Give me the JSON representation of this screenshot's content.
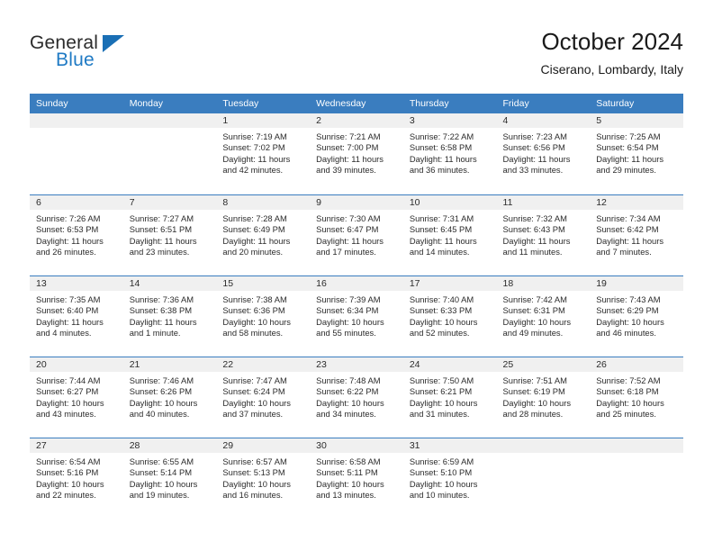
{
  "brand": {
    "name_part1": "General",
    "name_part2": "Blue",
    "triangle_icon": "logo-triangle",
    "accent_color": "#1a6fb5"
  },
  "header": {
    "title": "October 2024",
    "subtitle": "Ciserano, Lombardy, Italy"
  },
  "theme": {
    "header_band": "#3a7dbf",
    "daynum_band": "#f0f0f0",
    "text": "#2b2b2b"
  },
  "weekday_headers": [
    "Sunday",
    "Monday",
    "Tuesday",
    "Wednesday",
    "Thursday",
    "Friday",
    "Saturday"
  ],
  "labels": {
    "sunrise_prefix": "Sunrise:",
    "sunset_prefix": "Sunset:",
    "daylight_prefix": "Daylight:"
  },
  "weeks": [
    [
      {
        "day": "",
        "sunrise": "",
        "sunset": "",
        "daylight_line1": "",
        "daylight_line2": ""
      },
      {
        "day": "",
        "sunrise": "",
        "sunset": "",
        "daylight_line1": "",
        "daylight_line2": ""
      },
      {
        "day": "1",
        "sunrise": "Sunrise: 7:19 AM",
        "sunset": "Sunset: 7:02 PM",
        "daylight_line1": "Daylight: 11 hours",
        "daylight_line2": "and 42 minutes."
      },
      {
        "day": "2",
        "sunrise": "Sunrise: 7:21 AM",
        "sunset": "Sunset: 7:00 PM",
        "daylight_line1": "Daylight: 11 hours",
        "daylight_line2": "and 39 minutes."
      },
      {
        "day": "3",
        "sunrise": "Sunrise: 7:22 AM",
        "sunset": "Sunset: 6:58 PM",
        "daylight_line1": "Daylight: 11 hours",
        "daylight_line2": "and 36 minutes."
      },
      {
        "day": "4",
        "sunrise": "Sunrise: 7:23 AM",
        "sunset": "Sunset: 6:56 PM",
        "daylight_line1": "Daylight: 11 hours",
        "daylight_line2": "and 33 minutes."
      },
      {
        "day": "5",
        "sunrise": "Sunrise: 7:25 AM",
        "sunset": "Sunset: 6:54 PM",
        "daylight_line1": "Daylight: 11 hours",
        "daylight_line2": "and 29 minutes."
      }
    ],
    [
      {
        "day": "6",
        "sunrise": "Sunrise: 7:26 AM",
        "sunset": "Sunset: 6:53 PM",
        "daylight_line1": "Daylight: 11 hours",
        "daylight_line2": "and 26 minutes."
      },
      {
        "day": "7",
        "sunrise": "Sunrise: 7:27 AM",
        "sunset": "Sunset: 6:51 PM",
        "daylight_line1": "Daylight: 11 hours",
        "daylight_line2": "and 23 minutes."
      },
      {
        "day": "8",
        "sunrise": "Sunrise: 7:28 AM",
        "sunset": "Sunset: 6:49 PM",
        "daylight_line1": "Daylight: 11 hours",
        "daylight_line2": "and 20 minutes."
      },
      {
        "day": "9",
        "sunrise": "Sunrise: 7:30 AM",
        "sunset": "Sunset: 6:47 PM",
        "daylight_line1": "Daylight: 11 hours",
        "daylight_line2": "and 17 minutes."
      },
      {
        "day": "10",
        "sunrise": "Sunrise: 7:31 AM",
        "sunset": "Sunset: 6:45 PM",
        "daylight_line1": "Daylight: 11 hours",
        "daylight_line2": "and 14 minutes."
      },
      {
        "day": "11",
        "sunrise": "Sunrise: 7:32 AM",
        "sunset": "Sunset: 6:43 PM",
        "daylight_line1": "Daylight: 11 hours",
        "daylight_line2": "and 11 minutes."
      },
      {
        "day": "12",
        "sunrise": "Sunrise: 7:34 AM",
        "sunset": "Sunset: 6:42 PM",
        "daylight_line1": "Daylight: 11 hours",
        "daylight_line2": "and 7 minutes."
      }
    ],
    [
      {
        "day": "13",
        "sunrise": "Sunrise: 7:35 AM",
        "sunset": "Sunset: 6:40 PM",
        "daylight_line1": "Daylight: 11 hours",
        "daylight_line2": "and 4 minutes."
      },
      {
        "day": "14",
        "sunrise": "Sunrise: 7:36 AM",
        "sunset": "Sunset: 6:38 PM",
        "daylight_line1": "Daylight: 11 hours",
        "daylight_line2": "and 1 minute."
      },
      {
        "day": "15",
        "sunrise": "Sunrise: 7:38 AM",
        "sunset": "Sunset: 6:36 PM",
        "daylight_line1": "Daylight: 10 hours",
        "daylight_line2": "and 58 minutes."
      },
      {
        "day": "16",
        "sunrise": "Sunrise: 7:39 AM",
        "sunset": "Sunset: 6:34 PM",
        "daylight_line1": "Daylight: 10 hours",
        "daylight_line2": "and 55 minutes."
      },
      {
        "day": "17",
        "sunrise": "Sunrise: 7:40 AM",
        "sunset": "Sunset: 6:33 PM",
        "daylight_line1": "Daylight: 10 hours",
        "daylight_line2": "and 52 minutes."
      },
      {
        "day": "18",
        "sunrise": "Sunrise: 7:42 AM",
        "sunset": "Sunset: 6:31 PM",
        "daylight_line1": "Daylight: 10 hours",
        "daylight_line2": "and 49 minutes."
      },
      {
        "day": "19",
        "sunrise": "Sunrise: 7:43 AM",
        "sunset": "Sunset: 6:29 PM",
        "daylight_line1": "Daylight: 10 hours",
        "daylight_line2": "and 46 minutes."
      }
    ],
    [
      {
        "day": "20",
        "sunrise": "Sunrise: 7:44 AM",
        "sunset": "Sunset: 6:27 PM",
        "daylight_line1": "Daylight: 10 hours",
        "daylight_line2": "and 43 minutes."
      },
      {
        "day": "21",
        "sunrise": "Sunrise: 7:46 AM",
        "sunset": "Sunset: 6:26 PM",
        "daylight_line1": "Daylight: 10 hours",
        "daylight_line2": "and 40 minutes."
      },
      {
        "day": "22",
        "sunrise": "Sunrise: 7:47 AM",
        "sunset": "Sunset: 6:24 PM",
        "daylight_line1": "Daylight: 10 hours",
        "daylight_line2": "and 37 minutes."
      },
      {
        "day": "23",
        "sunrise": "Sunrise: 7:48 AM",
        "sunset": "Sunset: 6:22 PM",
        "daylight_line1": "Daylight: 10 hours",
        "daylight_line2": "and 34 minutes."
      },
      {
        "day": "24",
        "sunrise": "Sunrise: 7:50 AM",
        "sunset": "Sunset: 6:21 PM",
        "daylight_line1": "Daylight: 10 hours",
        "daylight_line2": "and 31 minutes."
      },
      {
        "day": "25",
        "sunrise": "Sunrise: 7:51 AM",
        "sunset": "Sunset: 6:19 PM",
        "daylight_line1": "Daylight: 10 hours",
        "daylight_line2": "and 28 minutes."
      },
      {
        "day": "26",
        "sunrise": "Sunrise: 7:52 AM",
        "sunset": "Sunset: 6:18 PM",
        "daylight_line1": "Daylight: 10 hours",
        "daylight_line2": "and 25 minutes."
      }
    ],
    [
      {
        "day": "27",
        "sunrise": "Sunrise: 6:54 AM",
        "sunset": "Sunset: 5:16 PM",
        "daylight_line1": "Daylight: 10 hours",
        "daylight_line2": "and 22 minutes."
      },
      {
        "day": "28",
        "sunrise": "Sunrise: 6:55 AM",
        "sunset": "Sunset: 5:14 PM",
        "daylight_line1": "Daylight: 10 hours",
        "daylight_line2": "and 19 minutes."
      },
      {
        "day": "29",
        "sunrise": "Sunrise: 6:57 AM",
        "sunset": "Sunset: 5:13 PM",
        "daylight_line1": "Daylight: 10 hours",
        "daylight_line2": "and 16 minutes."
      },
      {
        "day": "30",
        "sunrise": "Sunrise: 6:58 AM",
        "sunset": "Sunset: 5:11 PM",
        "daylight_line1": "Daylight: 10 hours",
        "daylight_line2": "and 13 minutes."
      },
      {
        "day": "31",
        "sunrise": "Sunrise: 6:59 AM",
        "sunset": "Sunset: 5:10 PM",
        "daylight_line1": "Daylight: 10 hours",
        "daylight_line2": "and 10 minutes."
      },
      {
        "day": "",
        "sunrise": "",
        "sunset": "",
        "daylight_line1": "",
        "daylight_line2": ""
      },
      {
        "day": "",
        "sunrise": "",
        "sunset": "",
        "daylight_line1": "",
        "daylight_line2": ""
      }
    ]
  ]
}
